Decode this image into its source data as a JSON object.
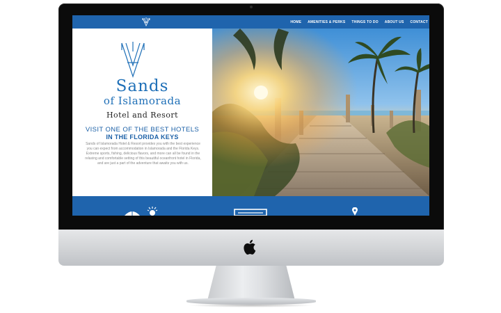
{
  "site": {
    "nav": {
      "items": [
        "HOME",
        "AMENITIES & PERKS",
        "THINGS TO DO",
        "ABOUT US",
        "CONTACT"
      ]
    },
    "brand": {
      "line1": "Sands",
      "line2": "of Islamorada",
      "line3": "Hotel and Resort"
    },
    "hero": {
      "headline1": "VISIT ONE OF THE BEST HOTELS",
      "headline2": "IN THE FLORIDA KEYS",
      "body": "Sands of Islamorada Hotel & Resort provides you with the best experience you can expect from accommodation in Islamorada and the Florida Keys. Extreme sports, fishing, delicious flavors, and more can all be found in the relaxing and comfortable setting of this beautiful oceanfront hotel in Florida, and are just a part of the adventure that awaits you with us."
    },
    "features": {
      "icons": [
        "beach-umbrella-icon",
        "sun-icon",
        "bed-icon",
        "location-pin-icon"
      ]
    }
  },
  "colors": {
    "brand_blue": "#1f64ad",
    "logo_blue": "#1e6fb7",
    "bezel": "#0b0b0b",
    "chin_silver": "#d3d5d8"
  }
}
